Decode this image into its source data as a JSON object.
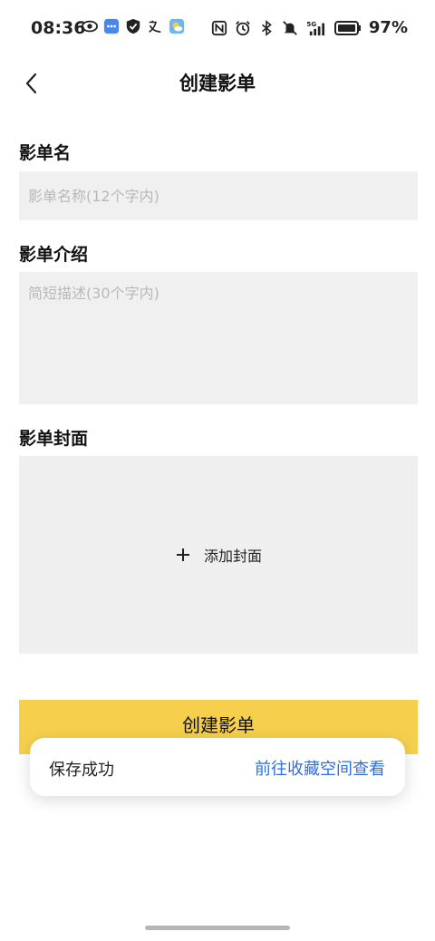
{
  "status_bar": {
    "time": "08:36",
    "battery_percent": "97%",
    "left_icons": [
      "eye-icon",
      "chat-app-icon",
      "shield-icon",
      "translate-icon",
      "weather-icon"
    ],
    "right_icons": [
      "nfc-icon",
      "alarm-icon",
      "bluetooth-icon",
      "mute-icon",
      "signal-5g-icon",
      "battery-icon"
    ]
  },
  "header": {
    "title": "创建影单"
  },
  "form": {
    "name_label": "影单名",
    "name_placeholder": "影单名称(12个字内)",
    "intro_label": "影单介绍",
    "intro_placeholder": "简短描述(30个字内)",
    "cover_label": "影单封面",
    "add_cover": "添加封面",
    "submit_label": "创建影单"
  },
  "toast": {
    "message": "保存成功",
    "action": "前往收藏空间查看"
  },
  "colors": {
    "accent": "#f6d04d",
    "link": "#2f6fe0",
    "field_bg": "#f0f0f0"
  }
}
